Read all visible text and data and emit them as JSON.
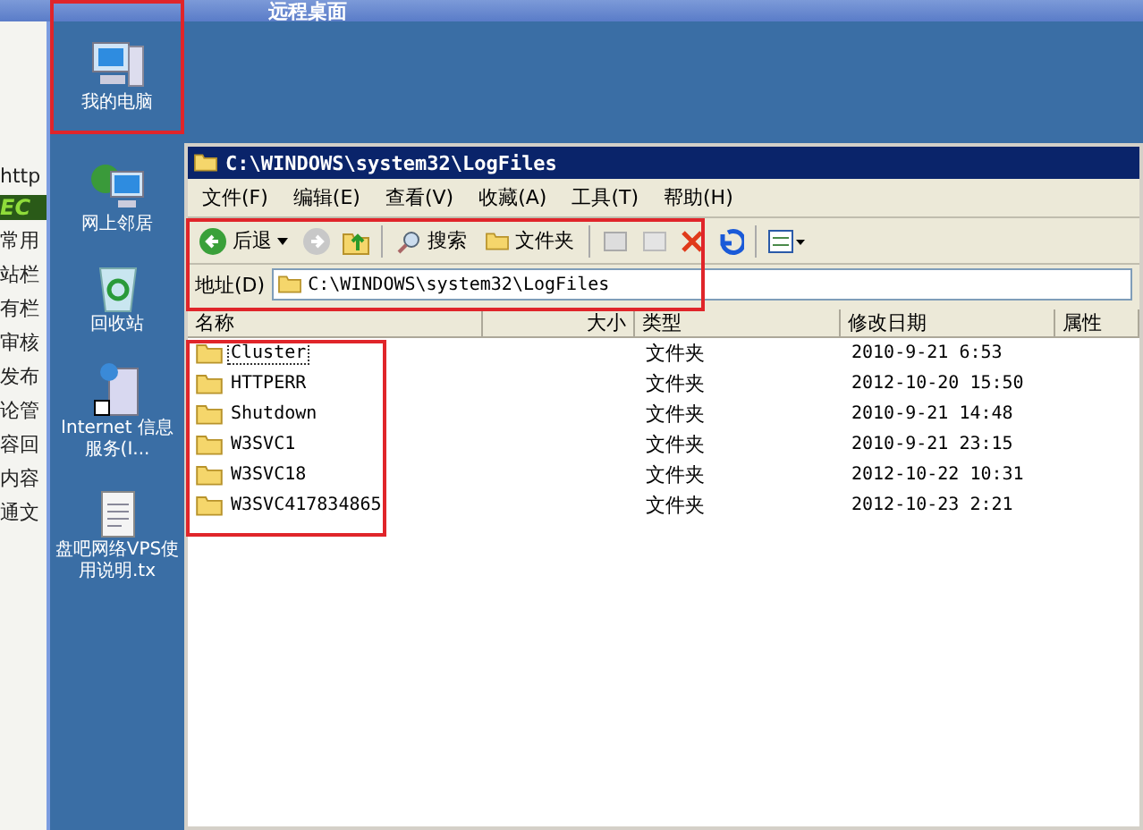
{
  "remote_title": "远程桌面",
  "browser_strip": {
    "url_fragment": "http",
    "logo_fragment": "EC",
    "items": [
      "常用",
      "站栏",
      "有栏",
      "审核",
      "发布",
      "论管",
      "容回",
      "内容",
      "通文"
    ]
  },
  "desktop_icons": [
    {
      "kind": "computer",
      "label": "我的电脑"
    },
    {
      "kind": "network",
      "label": "网上邻居"
    },
    {
      "kind": "recycle",
      "label": "回收站"
    },
    {
      "kind": "server",
      "label": "Internet 信息服务(I..."
    },
    {
      "kind": "text",
      "label": "盘吧网络VPS使用说明.tx"
    }
  ],
  "window": {
    "title": "C:\\WINDOWS\\system32\\LogFiles"
  },
  "menu": [
    "文件(F)",
    "编辑(E)",
    "查看(V)",
    "收藏(A)",
    "工具(T)",
    "帮助(H)"
  ],
  "toolbar": {
    "back": "后退",
    "search": "搜索",
    "folders": "文件夹"
  },
  "address": {
    "label": "地址(D)",
    "value": "C:\\WINDOWS\\system32\\LogFiles"
  },
  "table": {
    "columns": [
      "名称",
      "大小",
      "类型",
      "修改日期",
      "属性"
    ],
    "rows": [
      {
        "name": "Cluster",
        "selected": true,
        "type": "文件夹",
        "modified": "2010-9-21 6:53"
      },
      {
        "name": "HTTPERR",
        "selected": false,
        "type": "文件夹",
        "modified": "2012-10-20 15:50"
      },
      {
        "name": "Shutdown",
        "selected": false,
        "type": "文件夹",
        "modified": "2010-9-21 14:48"
      },
      {
        "name": "W3SVC1",
        "selected": false,
        "type": "文件夹",
        "modified": "2010-9-21 23:15"
      },
      {
        "name": "W3SVC18",
        "selected": false,
        "type": "文件夹",
        "modified": "2012-10-22 10:31"
      },
      {
        "name": "W3SVC417834865",
        "selected": false,
        "type": "文件夹",
        "modified": "2012-10-23 2:21"
      }
    ]
  }
}
